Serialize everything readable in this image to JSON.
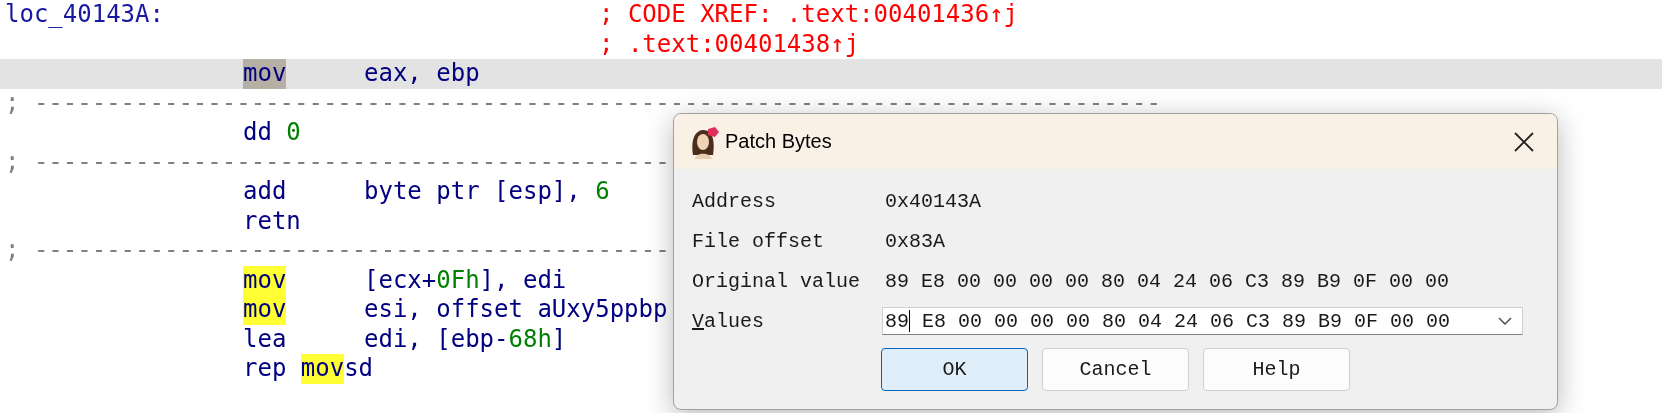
{
  "listing": {
    "lines": [
      {
        "kind": "label",
        "text": "loc_40143A:",
        "comment": "; CODE XREF: .text:00401436↑j"
      },
      {
        "kind": "comment",
        "comment": "; .text:00401438↑j"
      },
      {
        "kind": "instr",
        "current": true,
        "code": [
          {
            "text": "mov",
            "highlighted": true
          }
        ],
        "operands": [
          {
            "text": "eax, ebp"
          }
        ]
      },
      {
        "kind": "separator",
        "text": "; ------------------------------------------------------------------------------"
      },
      {
        "kind": "instr",
        "current": false,
        "code": [
          {
            "text": "dd "
          },
          {
            "text": "0",
            "number": true
          }
        ]
      },
      {
        "kind": "separator",
        "text": "; --------------------------------------------"
      },
      {
        "kind": "instr",
        "current": false,
        "code": [
          {
            "text": "add"
          }
        ],
        "operands": [
          {
            "text": "byte ptr [esp], "
          },
          {
            "text": "6",
            "number": true
          }
        ]
      },
      {
        "kind": "instr",
        "current": false,
        "code": [
          {
            "text": "retn"
          }
        ]
      },
      {
        "kind": "separator",
        "text": "; --------------------------------------------"
      },
      {
        "kind": "instr",
        "current": false,
        "code": [
          {
            "text": "mov",
            "highlighted": true
          }
        ],
        "operands": [
          {
            "text": "[ecx+"
          },
          {
            "text": "0Fh",
            "number": true
          },
          {
            "text": "], edi"
          }
        ]
      },
      {
        "kind": "instr",
        "current": false,
        "code": [
          {
            "text": "mov",
            "highlighted": true
          }
        ],
        "operands": [
          {
            "text": "esi, offset aUxy5ppbp"
          }
        ]
      },
      {
        "kind": "instr",
        "current": false,
        "code": [
          {
            "text": "lea"
          }
        ],
        "operands": [
          {
            "text": "edi, [ebp-"
          },
          {
            "text": "68h",
            "number": true
          },
          {
            "text": "]"
          }
        ]
      },
      {
        "kind": "instr",
        "current": false,
        "code": [
          {
            "text": "rep "
          },
          {
            "text": "mov",
            "highlighted": true
          },
          {
            "text": "sd"
          }
        ]
      }
    ]
  },
  "dialog": {
    "title": "Patch Bytes",
    "fields": [
      {
        "label": "Address",
        "value": "0x40143A"
      },
      {
        "label": "File offset",
        "value": "0x83A"
      },
      {
        "label": "Original value",
        "value": "89 E8 00 00 00 00 80 04 24 06 C3 89 B9 0F 00 00"
      }
    ],
    "values": {
      "label": "Values",
      "mnemonic_underlined": true,
      "text_before_cursor": "89",
      "text_after_cursor": " E8 00 00 00 00 80 04 24 06 C3 89 B9 0F 00 00"
    },
    "buttons": [
      {
        "label": "OK",
        "default": true
      },
      {
        "label": "Cancel",
        "default": false
      },
      {
        "label": "Help",
        "default": false
      }
    ]
  }
}
